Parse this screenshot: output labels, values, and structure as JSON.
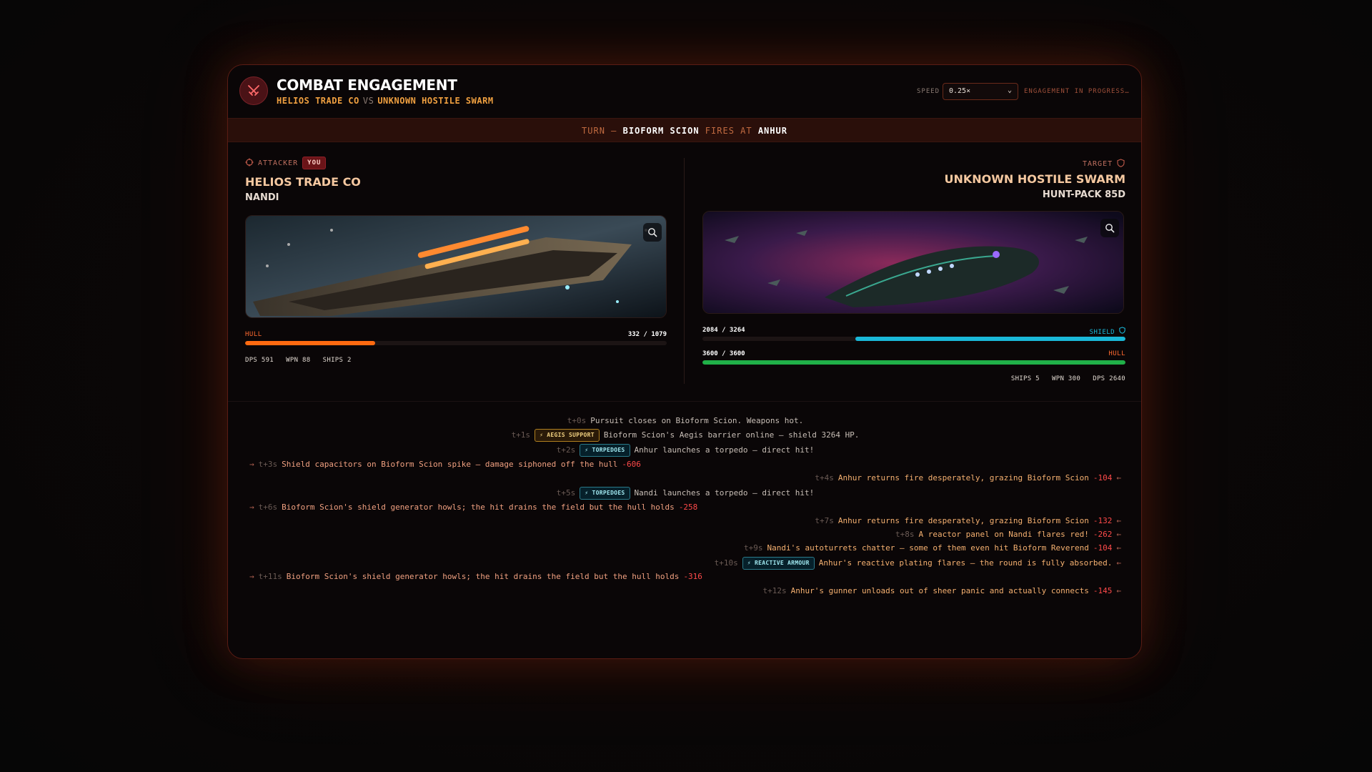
{
  "header": {
    "title": "COMBAT ENGAGEMENT",
    "attacker": "HELIOS TRADE CO",
    "vs": "VS",
    "defender": "UNKNOWN HOSTILE SWARM",
    "speed_label": "SPEED",
    "speed_value": "0.25×",
    "status": "ENGAGEMENT IN PROGRESS…"
  },
  "turn": {
    "prefix": "TURN —",
    "actor": "BIOFORM SCION",
    "verb": "FIRES AT",
    "target": "ANHUR"
  },
  "attacker": {
    "role": "ATTACKER",
    "badge": "YOU",
    "faction": "HELIOS TRADE CO",
    "fleet": "NANDI",
    "hull_label": "HULL",
    "hull_text": "332 / 1079",
    "hull_fraction": 0.308,
    "stats": "DPS 591   WPN 88   SHIPS 2",
    "colors": {
      "hull": "#ff6a10"
    }
  },
  "defender": {
    "role": "TARGET",
    "faction": "UNKNOWN HOSTILE SWARM",
    "fleet": "HUNT-PACK 85D",
    "shield_label": "SHIELD",
    "shield_text": "2084 / 3264",
    "shield_fraction": 0.638,
    "hull_label": "HULL",
    "hull_text": "3600 / 3600",
    "hull_fraction": 1.0,
    "stats": "SHIPS 5   WPN 300   DPS 2640",
    "colors": {
      "shield": "#1ab8d8",
      "hull": "#20b048"
    }
  },
  "log": [
    {
      "side": "center",
      "t": "t+0s",
      "text": "Pursuit closes on Bioform Scion. Weapons hot."
    },
    {
      "side": "center",
      "t": "t+1s",
      "tag": "AEGIS SUPPORT",
      "tag_style": "gold",
      "text": "Bioform Scion's Aegis barrier online — shield 3264 HP."
    },
    {
      "side": "center",
      "t": "t+2s",
      "tag": "TORPEDOES",
      "tag_style": "teal",
      "text": "Anhur launches a torpedo — direct hit!"
    },
    {
      "side": "left",
      "t": "t+3s",
      "text": "Shield capacitors on Bioform Scion spike — damage siphoned off the hull",
      "dmg": "-606"
    },
    {
      "side": "right",
      "t": "t+4s",
      "text": "Anhur returns fire desperately, grazing Bioform Scion",
      "dmg": "-104"
    },
    {
      "side": "center",
      "t": "t+5s",
      "tag": "TORPEDOES",
      "tag_style": "teal",
      "text": "Nandi launches a torpedo — direct hit!"
    },
    {
      "side": "left",
      "t": "t+6s",
      "text": "Bioform Scion's shield generator howls; the hit drains the field but the hull holds",
      "dmg": "-258"
    },
    {
      "side": "right",
      "t": "t+7s",
      "text": "Anhur returns fire desperately, grazing Bioform Scion",
      "dmg": "-132"
    },
    {
      "side": "right",
      "t": "t+8s",
      "text": "A reactor panel on Nandi flares red!",
      "dmg": "-262"
    },
    {
      "side": "right",
      "t": "t+9s",
      "text": "Nandi's autoturrets chatter — some of them even hit Bioform Reverend",
      "dmg": "-104"
    },
    {
      "side": "right",
      "t": "t+10s",
      "tag": "REACTIVE ARMOUR",
      "tag_style": "teal",
      "text": "Anhur's reactive plating flares — the round is fully absorbed.",
      "dmg": ""
    },
    {
      "side": "left",
      "t": "t+11s",
      "text": "Bioform Scion's shield generator howls; the hit drains the field but the hull holds",
      "dmg": "-316"
    },
    {
      "side": "right",
      "t": "t+12s",
      "text": "Anhur's gunner unloads out of sheer panic and actually connects",
      "dmg": "-145"
    }
  ],
  "icons": {
    "emblem": "crossed-swords-icon",
    "attacker_role": "crosshair-icon",
    "target_role": "shield-icon",
    "zoom": "magnifier-icon",
    "arrow_in": "arrow-right-icon",
    "arrow_out": "arrow-left-icon"
  }
}
